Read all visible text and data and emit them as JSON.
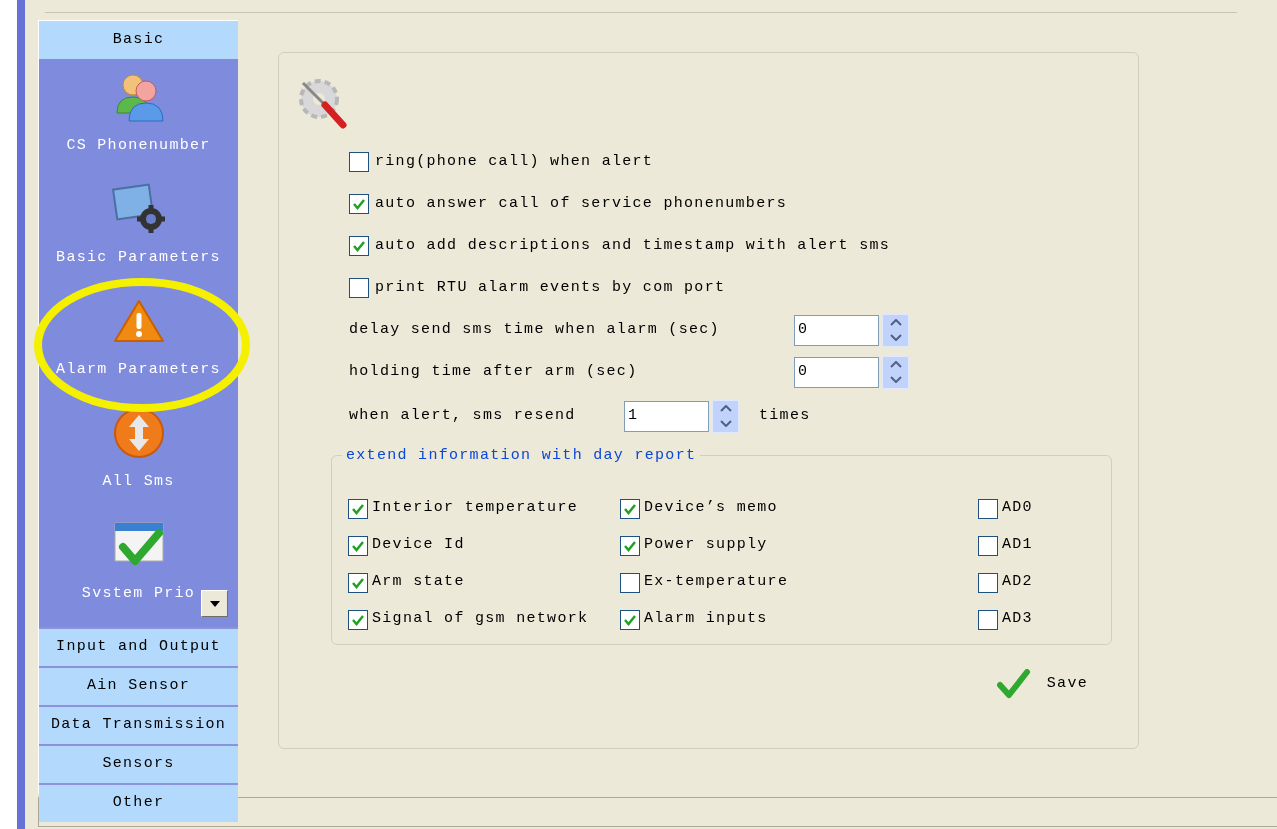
{
  "sidebar": {
    "header": {
      "label": "Basic"
    },
    "items": [
      {
        "kind": "people",
        "label": "CS Phonenumber"
      },
      {
        "kind": "monitor",
        "label": "Basic Parameters"
      },
      {
        "kind": "warning",
        "label": "Alarm Parameters"
      },
      {
        "kind": "updown",
        "label": "All Sms"
      },
      {
        "kind": "calendar",
        "label": "Svstem Prio"
      }
    ],
    "sections": [
      {
        "label": "Input and Output"
      },
      {
        "label": "Ain Sensor"
      },
      {
        "label": "Data Transmission"
      },
      {
        "label": "Sensors"
      },
      {
        "label": "Other"
      }
    ]
  },
  "options": [
    {
      "kind": "checkbox",
      "label": "ring(phone call) when alert",
      "checked": false
    },
    {
      "kind": "checkbox",
      "label": "auto answer call of service phonenumbers",
      "checked": true
    },
    {
      "kind": "checkbox",
      "label": "auto add descriptions and timestamp with alert sms",
      "checked": true
    },
    {
      "kind": "checkbox",
      "label": "print RTU alarm events by com port",
      "checked": false
    },
    {
      "kind": "spin",
      "label": "delay send sms time when alarm (sec)",
      "value": "0"
    },
    {
      "kind": "spin",
      "label": "holding time after arm (sec)",
      "value": "0"
    },
    {
      "kind": "spin",
      "label": "when alert, sms resend",
      "value": "1",
      "suffix": "times"
    }
  ],
  "day_report": {
    "title": "extend information with day report",
    "columns": [
      [
        {
          "label": "Interior temperature",
          "checked": true
        },
        {
          "label": "Device Id",
          "checked": true
        },
        {
          "label": "Arm state",
          "checked": true
        },
        {
          "label": "Signal of gsm network",
          "checked": true
        }
      ],
      [
        {
          "label": "Device’s memo",
          "checked": true
        },
        {
          "label": "Power supply",
          "checked": true
        },
        {
          "label": "Ex-temperature",
          "checked": false
        },
        {
          "label": "Alarm inputs",
          "checked": true
        }
      ],
      [
        {
          "label": "AD0",
          "checked": false
        },
        {
          "label": "AD1",
          "checked": false
        },
        {
          "label": "AD2",
          "checked": false
        },
        {
          "label": "AD3",
          "checked": false
        }
      ]
    ]
  },
  "save_button": {
    "label": "Save"
  }
}
